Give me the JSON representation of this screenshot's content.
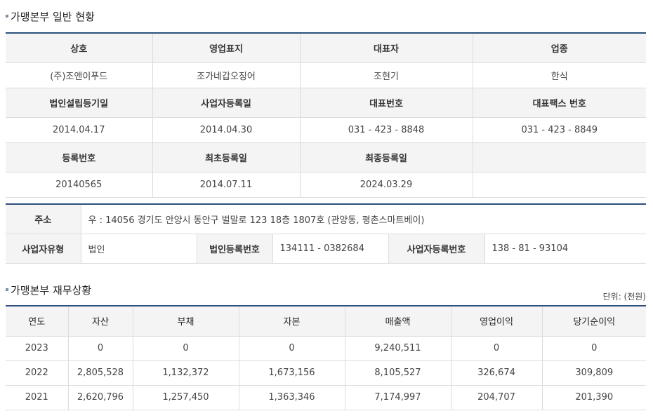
{
  "section1": {
    "title": "가맹본부 일반 현황",
    "headers_row1": [
      "상호",
      "영업표지",
      "대표자",
      "업종"
    ],
    "values_row1": [
      "(주)조앤이푸드",
      "조가네갑오징어",
      "조현기",
      "한식"
    ],
    "headers_row2": [
      "법인설립등기일",
      "사업자등록일",
      "대표번호",
      "대표팩스 번호"
    ],
    "values_row2": [
      "2014.04.17",
      "2014.04.30",
      "031 - 423 - 8848",
      "031 - 423 - 8849"
    ],
    "headers_row3": [
      "등록번호",
      "최초등록일",
      "최종등록일",
      ""
    ],
    "values_row3": [
      "20140565",
      "2014.07.11",
      "2024.03.29",
      ""
    ]
  },
  "address": {
    "label": "주소",
    "value": "우 : 14056 경기도 안양시 동안구 벌말로 123 18층 1807호 (관양동, 평촌스마트베이)",
    "biz_type_label": "사업자유형",
    "biz_type_value": "법인",
    "corp_no_label": "법인등록번호",
    "corp_no_value": "134111 - 0382684",
    "biz_no_label": "사업자등록번호",
    "biz_no_value": "138 - 81 - 93104"
  },
  "section2": {
    "title": "가맹본부 재무상황",
    "unit": "단위: (천원)",
    "headers": [
      "연도",
      "자산",
      "부채",
      "자본",
      "매출액",
      "영업이익",
      "당기순이익"
    ],
    "rows": [
      [
        "2023",
        "0",
        "0",
        "0",
        "9,240,511",
        "0",
        "0"
      ],
      [
        "2022",
        "2,805,528",
        "1,132,372",
        "1,673,156",
        "8,105,527",
        "326,674",
        "309,809"
      ],
      [
        "2021",
        "2,620,796",
        "1,257,450",
        "1,363,346",
        "7,174,997",
        "204,707",
        "201,390"
      ]
    ]
  }
}
